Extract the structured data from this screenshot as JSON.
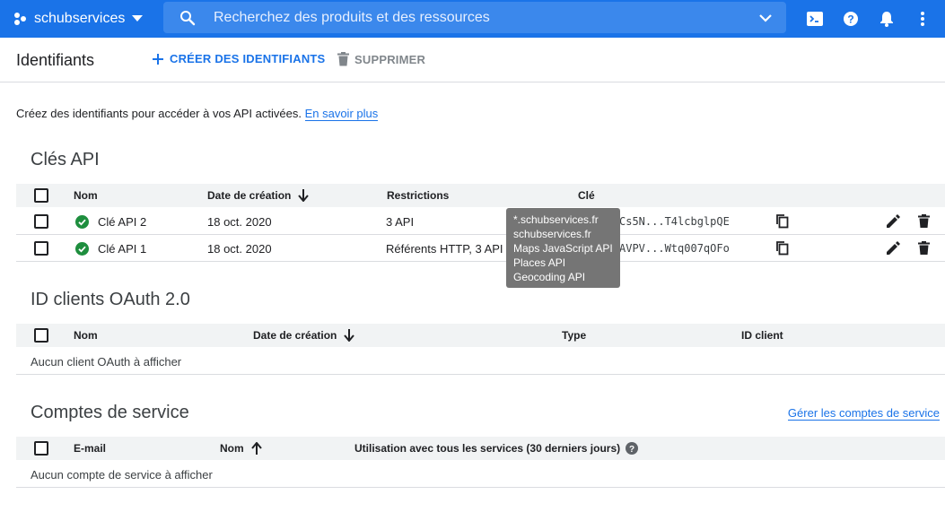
{
  "topbar": {
    "project_name": "schubservices",
    "search_placeholder": "Recherchez des produits et des ressources",
    "color": "#1a73e8"
  },
  "header": {
    "title": "Identifiants",
    "create_label": "CRÉER DES IDENTIFIANTS",
    "delete_label": "SUPPRIMER"
  },
  "intro": {
    "text": "Créez des identifiants pour accéder à vos API activées.",
    "link": "En savoir plus"
  },
  "api_keys": {
    "title": "Clés API",
    "columns": {
      "name": "Nom",
      "date": "Date de création",
      "restrictions": "Restrictions",
      "key": "Clé"
    },
    "rows": [
      {
        "name": "Clé API 2",
        "date": "18 oct. 2020",
        "restrictions": "3 API",
        "key": "Cs5N...T4lcbglpQE"
      },
      {
        "name": "Clé API 1",
        "date": "18 oct. 2020",
        "restrictions": "Référents HTTP, 3 API",
        "key": "AVPV...Wtq007qOFo"
      }
    ]
  },
  "tooltip": {
    "lines": [
      "*.schubservices.fr",
      "schubservices.fr",
      "Maps JavaScript API",
      "Places API",
      "Geocoding API"
    ]
  },
  "oauth": {
    "title": "ID clients OAuth 2.0",
    "columns": {
      "name": "Nom",
      "date": "Date de création",
      "type": "Type",
      "client_id": "ID client"
    },
    "empty": "Aucun client OAuth à afficher"
  },
  "service_accounts": {
    "title": "Comptes de service",
    "manage_link": "Gérer les comptes de service",
    "columns": {
      "email": "E-mail",
      "name": "Nom",
      "usage": "Utilisation avec tous les services (30 derniers jours)"
    },
    "empty": "Aucun compte de service à afficher"
  },
  "icons": {
    "project": "project-dots-icon",
    "search": "search-icon",
    "terminal": "cloud-shell-icon",
    "help": "help-icon",
    "notifications": "bell-icon",
    "more": "more-vert-icon",
    "status_ok": "check-circle-icon",
    "copy": "copy-icon",
    "edit": "pencil-icon",
    "delete": "trash-icon"
  }
}
